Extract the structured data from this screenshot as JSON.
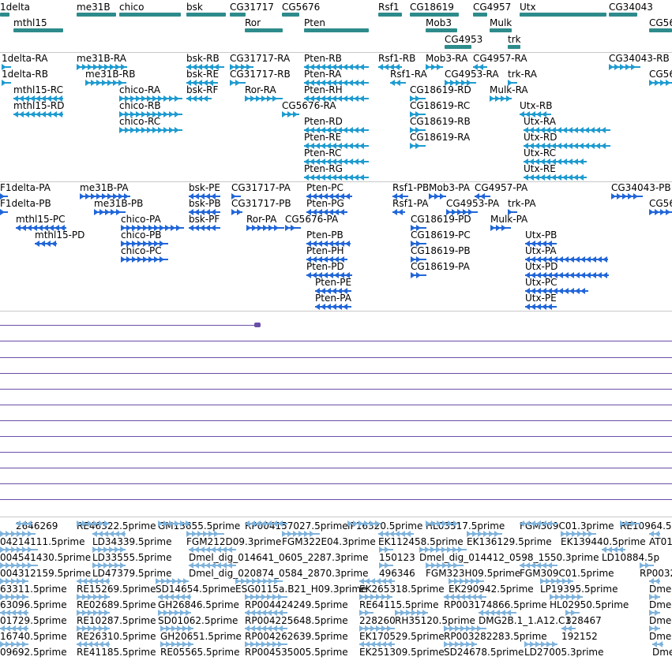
{
  "colors": {
    "gene": "#2e8b8b",
    "transcript": "#1e9bd0",
    "protein": "#2166d9",
    "est": "#7fb3dc",
    "wig_line": "#6a4fa8",
    "separator": "#c8c8c8"
  },
  "tracks": {
    "genes": {
      "labels": [
        "1delta",
        "me31B",
        "chico",
        "bsk",
        "CG31717",
        "CG5676",
        "Rsf1",
        "CG18619",
        "CG4957",
        "Utx",
        "CG34043",
        "mthl15",
        "Ror",
        "Pten",
        "Mob3",
        "Mulk",
        "CG56",
        "CG4953",
        "trk"
      ]
    },
    "transcripts": {
      "labels": [
        "1delta-RA",
        "me31B-RA",
        "bsk-RB",
        "CG31717-RA",
        "Pten-RB",
        "Rsf1-RB",
        "Mob3-RA",
        "CG4957-RA",
        "CG34043-RB",
        "1delta-RB",
        "me31B-RB",
        "bsk-RE",
        "CG31717-RB",
        "Pten-RA",
        "Rsf1-RA",
        "CG4953-RA",
        "trk-RA",
        "CG56",
        "mthl15-RC",
        "chico-RA",
        "bsk-RF",
        "Ror-RA",
        "Pten-RH",
        "CG18619-RD",
        "Mulk-RA",
        "mthl15-RD",
        "chico-RB",
        "CG5676-RA",
        "CG18619-RC",
        "Utx-RB",
        "chico-RC",
        "Pten-RD",
        "CG18619-RB",
        "Utx-RA",
        "Pten-RE",
        "CG18619-RA",
        "Utx-RD",
        "Pten-RC",
        "Utx-RC",
        "Pten-RG",
        "Utx-RE"
      ]
    },
    "proteins": {
      "labels": [
        "F1delta-PA",
        "me31B-PA",
        "bsk-PE",
        "CG31717-PA",
        "Pten-PC",
        "Rsf1-PB",
        "Mob3-PA",
        "CG4957-PA",
        "CG34043-PB",
        "F1delta-PB",
        "me31B-PB",
        "bsk-PB",
        "CG31717-PB",
        "Pten-PG",
        "Rsf1-PA",
        "CG4953-PA",
        "trk-PA",
        "CG56",
        "mthl15-PC",
        "chico-PA",
        "bsk-PF",
        "Ror-PA",
        "CG5676-PA",
        "CG18619-PD",
        "Mulk-PA",
        "mthl15-PD",
        "chico-PB",
        "Pten-PB",
        "CG18619-PC",
        "Utx-PB",
        "chico-PC",
        "Pten-PH",
        "CG18619-PB",
        "Utx-PA",
        "Pten-PD",
        "CG18619-PA",
        "Utx-PD",
        "Pten-PE",
        "Utx-PC",
        "Pten-PA",
        "Utx-PE"
      ]
    },
    "ests": {
      "labels": [
        "2646269",
        "RE46322.5prime",
        "GM13655.5prime",
        "RP004157027.5prime",
        "IP16320.5prime",
        "HL03517.5prime",
        "FGM309C01.3prime",
        "RE10964.5",
        "04214111.5prime",
        "LD34339.5prime",
        "FGM212D09.3prime",
        "FGM322E04.3prime",
        "EK112458.5prime",
        "EK136129.5prime",
        "EK139440.5prime",
        "AT01",
        "004541430.5prime",
        "LD33555.5prime",
        "Dmel_dig_014641_0605_2287.3prime",
        "150123",
        "Dmel_dig_014412_0598_1550.3prime",
        "LD10884.5p",
        "004312159.5prime",
        "LD47379.5prime",
        "Dmel_dig_020874_0584_2870.3prime",
        "496346",
        "FGM323H09.5prime",
        "FGM309C01.5prime",
        "RP0032",
        "63311.5prime",
        "RE15269.5prime",
        "SD14654.5prime",
        "ESG0115a.B21_H09.3prime",
        "EK265318.5prime",
        "EK290942.5prime",
        "LP19395.5prime",
        "Dme",
        "63096.5prime",
        "RE02689.5prime",
        "GH26846.5prime",
        "RP004424249.5prime",
        "RE64115.5prime",
        "RP003174866.5prime",
        "HL02950.5prime",
        "Dme",
        "01729.5prime",
        "RE10287.5prime",
        "SD01062.5prime",
        "RP004225648.5prime",
        "228260",
        "RH35120.5prime",
        "DMG2B.1_1.A12.C1",
        "328467",
        "Dme",
        "16740.5prime",
        "RE26310.5prime",
        "GH20651.5prime",
        "RP004262639.5prime",
        "EK170529.5prime",
        "RP003282283.5prime",
        "192152",
        "Dme",
        "09692.5prime",
        "RE41185.5prime",
        "RE05565.5prime",
        "RP004535005.5prime",
        "EK251309.5prime",
        "SD24678.5prime",
        "LD27005.3prime",
        "Dme"
      ]
    }
  }
}
